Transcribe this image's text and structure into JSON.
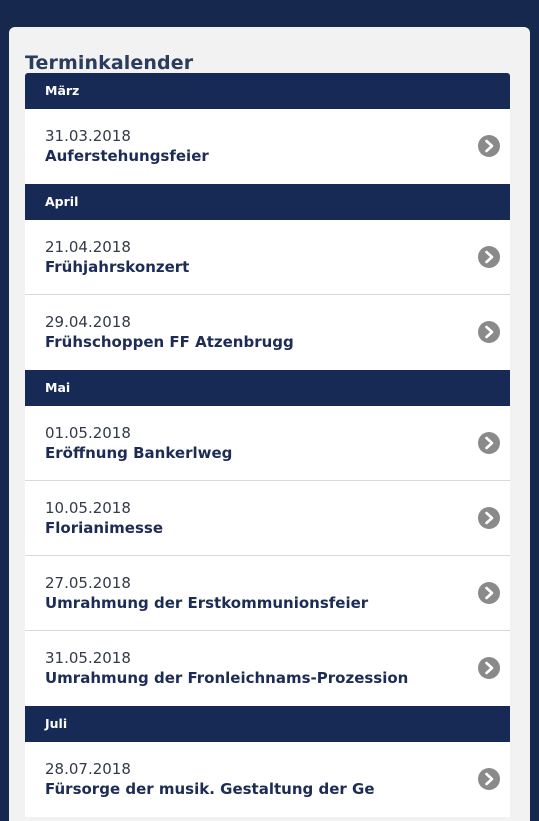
{
  "calendar": {
    "title": "Terminkalender",
    "months": [
      {
        "name": "März",
        "events": [
          {
            "date": "31.03.2018",
            "title": "Auferstehungsfeier"
          }
        ]
      },
      {
        "name": "April",
        "events": [
          {
            "date": "21.04.2018",
            "title": "Frühjahrskonzert"
          },
          {
            "date": "29.04.2018",
            "title": "Frühschoppen FF Atzenbrugg"
          }
        ]
      },
      {
        "name": "Mai",
        "events": [
          {
            "date": "01.05.2018",
            "title": "Eröffnung Bankerlweg"
          },
          {
            "date": "10.05.2018",
            "title": "Florianimesse"
          },
          {
            "date": "27.05.2018",
            "title": "Umrahmung der Erstkommunionsfeier"
          },
          {
            "date": "31.05.2018",
            "title": "Umrahmung der Fronleichnams-Prozession"
          }
        ]
      },
      {
        "name": "Juli",
        "events": [
          {
            "date": "28.07.2018",
            "title": "Fürsorge der musik. Gestaltung der Ge"
          }
        ]
      }
    ]
  },
  "icons": {
    "event_arrow": "chevron-right-circle-icon"
  },
  "colors": {
    "page_background": "#17284f",
    "panel_background": "#f2f2f2",
    "month_header": "#172a55",
    "title_text": "#1c2c55",
    "arrow_circle": "#8a8a8a"
  }
}
